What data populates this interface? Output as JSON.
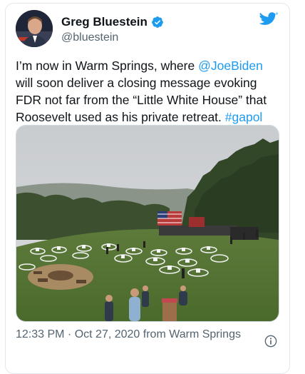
{
  "tweet": {
    "display_name": "Greg Bluestein",
    "handle": "@bluestein",
    "text_parts": {
      "p1": "I’m now in Warm Springs, where ",
      "mention": "@JoeBiden",
      "p2": " will soon deliver a closing message evoking FDR not far from the “Little White House” that Roosevelt used as his private retreat. ",
      "hashtag": "#gapol"
    },
    "timestamp": "12:33 PM · Oct 27, 2020 from Warm Springs",
    "icons": {
      "verified": "verified-badge-icon",
      "brand": "twitter-bird-icon",
      "info": "info-icon"
    }
  },
  "colors": {
    "link": "#1d9bf0",
    "verified": "#1d9bf0",
    "secondary_text": "#536471"
  }
}
